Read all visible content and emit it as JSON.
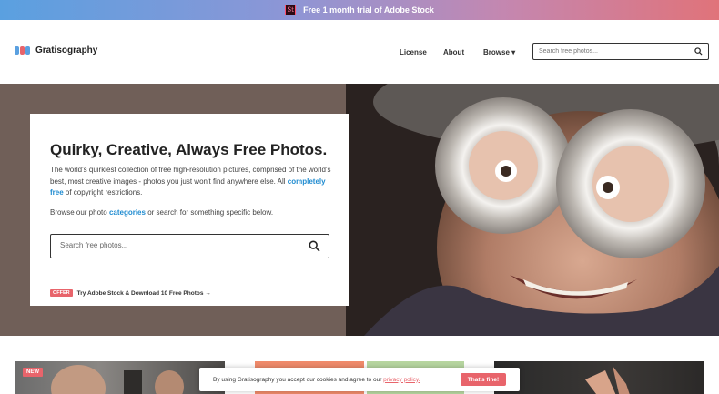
{
  "promo": {
    "text": "Free 1 month trial of Adobe Stock",
    "logo_text": "St"
  },
  "header": {
    "brand": "Gratisography",
    "nav": [
      {
        "label": "License"
      },
      {
        "label": "About"
      },
      {
        "label": "Browse ▾"
      }
    ],
    "search_placeholder": "Search free photos..."
  },
  "hero": {
    "title": "Quirky, Creative, Always Free Photos.",
    "desc_part1": "The world's quirkiest collection of free high-resolution pictures, comprised of the world's best, most creative images - photos you just won't find anywhere else. All ",
    "desc_link": "completely free",
    "desc_part2": " of copyright restrictions.",
    "browse_part1": "Browse our photo ",
    "browse_link": "categories",
    "browse_part2": " or search for something specific below.",
    "search_placeholder": "Search free photos...",
    "offer_badge": "OFFER",
    "offer_text": "Try Adobe Stock & Download 10 Free Photos →"
  },
  "thumbs": {
    "new_badge": "NEW"
  },
  "cookie": {
    "text_part1": "By using Gratisography you accept our cookies and agree to our ",
    "link": "privacy policy.",
    "button": "That's fine!"
  },
  "colors": {
    "accent": "#e8646b",
    "link": "#1f8bd0"
  },
  "icons": {
    "search": "search-icon",
    "logo": "gratisography-logo"
  }
}
